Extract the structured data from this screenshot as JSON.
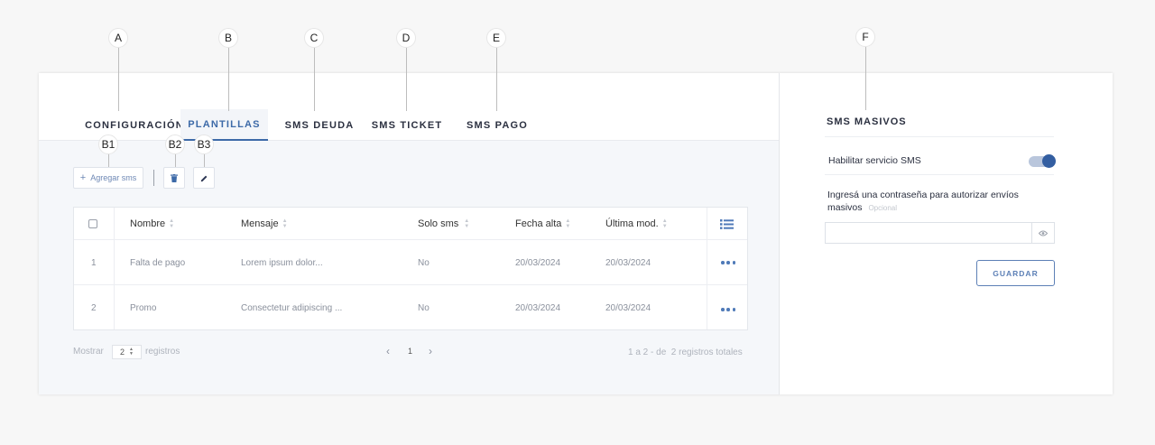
{
  "callouts": [
    "A",
    "B",
    "C",
    "D",
    "E",
    "F",
    "B1",
    "B2",
    "B3"
  ],
  "tabs": [
    {
      "label": "CONFIGURACIÓN",
      "active": false
    },
    {
      "label": "PLANTILLAS",
      "active": true
    },
    {
      "label": "SMS DEUDA",
      "active": false
    },
    {
      "label": "SMS TICKET",
      "active": false
    },
    {
      "label": "SMS PAGO",
      "active": false
    }
  ],
  "toolbar": {
    "add_label": "Agregar sms",
    "add_icon": "plus-icon",
    "delete_icon": "trash-icon",
    "edit_icon": "pencil-icon"
  },
  "table": {
    "headers": [
      "Nombre",
      "Mensaje",
      "Solo sms",
      "Fecha alta",
      "Última mod."
    ],
    "rows": [
      {
        "index": "1",
        "nombre": "Falta de pago",
        "mensaje": "Lorem ipsum dolor...",
        "solo_sms": "No",
        "fecha_alta": "20/03/2024",
        "ultima_mod": "20/03/2024"
      },
      {
        "index": "2",
        "nombre": "Promo",
        "mensaje": "Consectetur adipiscing ...",
        "solo_sms": "No",
        "fecha_alta": "20/03/2024",
        "ultima_mod": "20/03/2024"
      }
    ]
  },
  "footer": {
    "show_label": "Mostrar",
    "page_size": "2",
    "records_label": "registros",
    "current_page": "1",
    "summary": "1 a 2 - de  2 registros totales"
  },
  "sms_masivos": {
    "title": "SMS MASIVOS",
    "enable_label": "Habilitar servicio SMS",
    "enabled": true,
    "password_label": "Ingresá una contraseña para autorizar envíos masivos",
    "optional_label": "Opcional",
    "password_value": "",
    "save_label": "GUARDAR"
  },
  "colors": {
    "accent": "#3d6aa8",
    "toggle": "#335ea1"
  }
}
